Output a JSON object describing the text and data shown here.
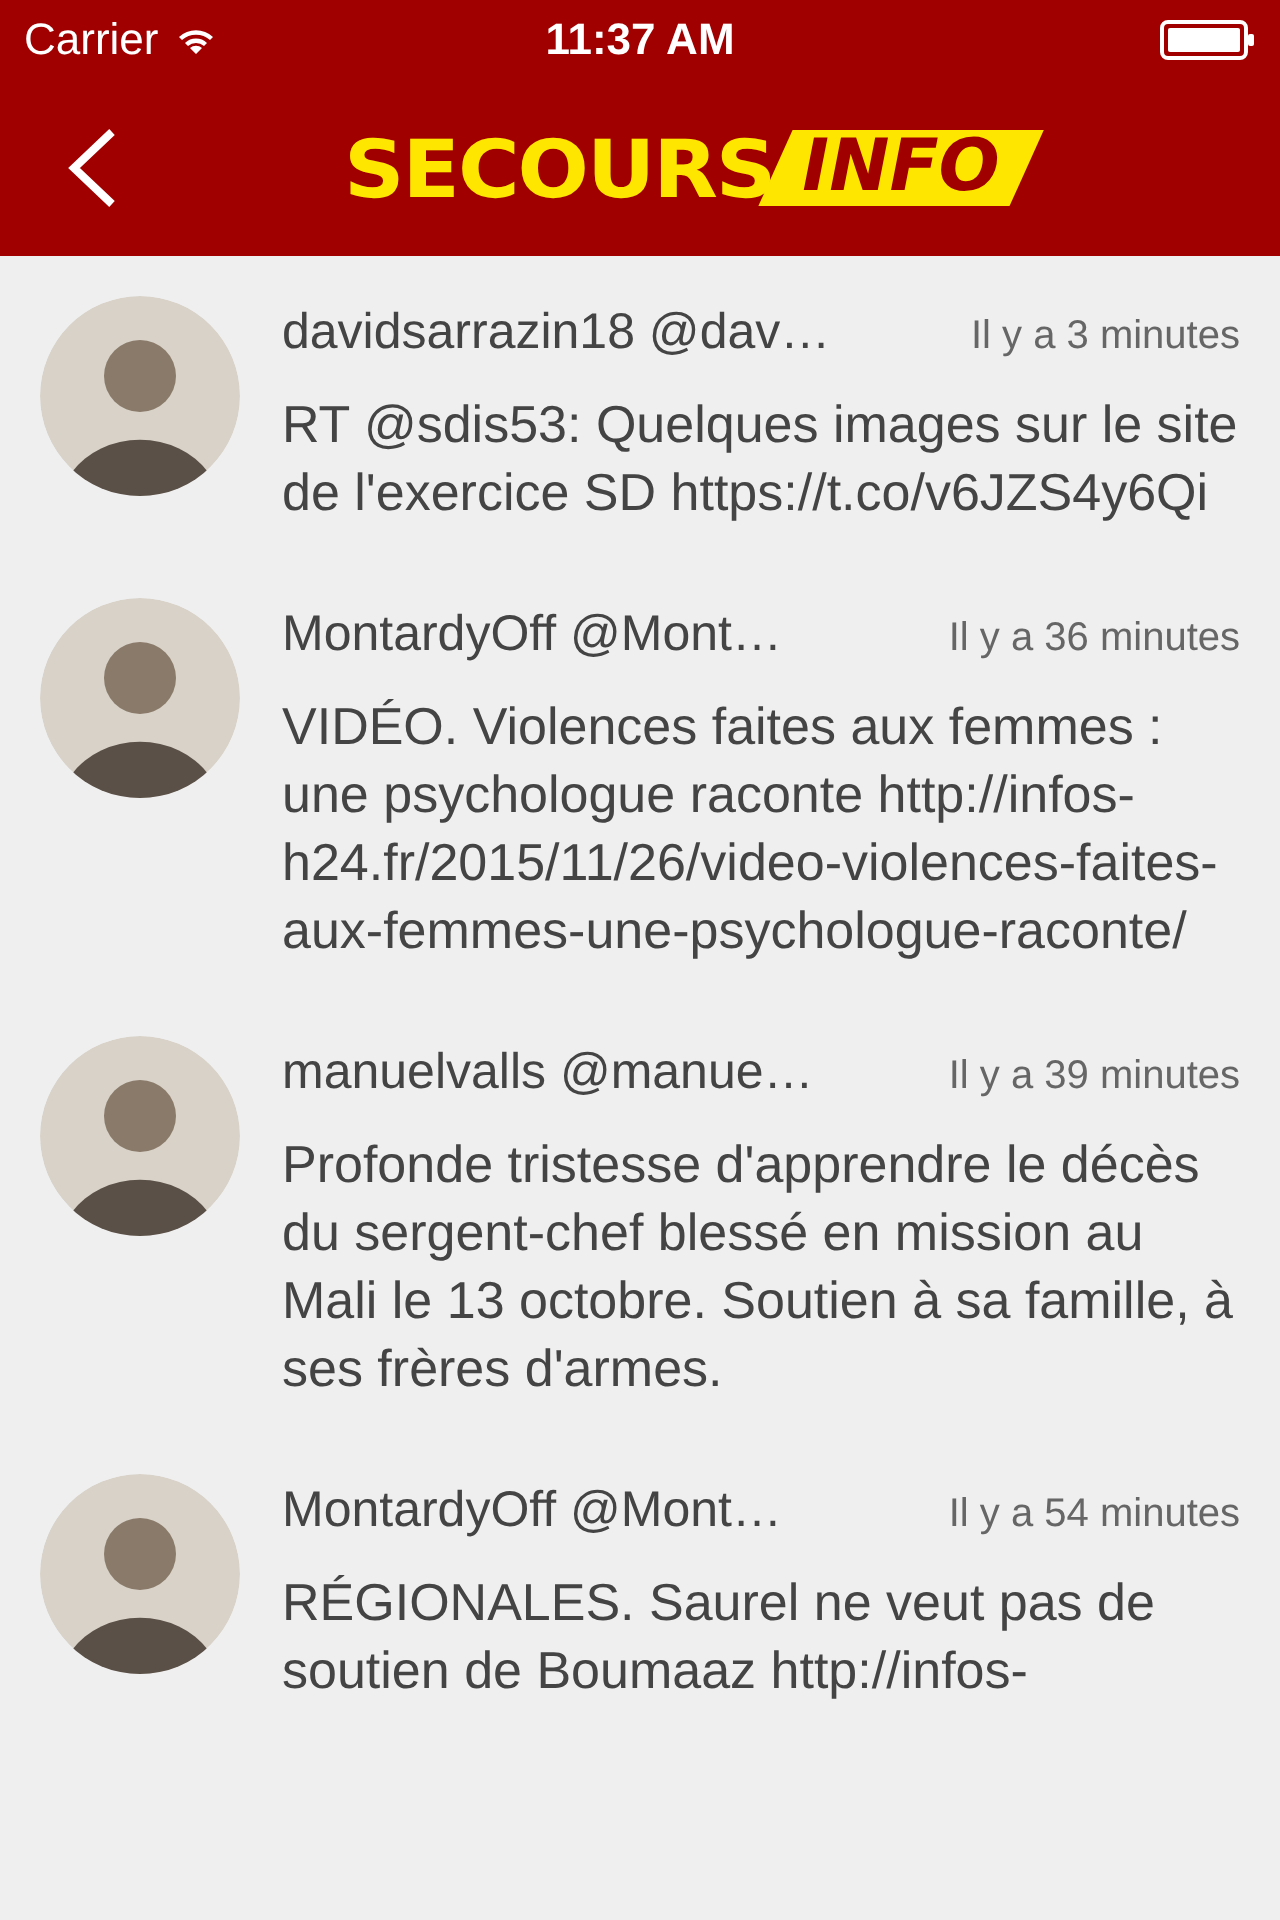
{
  "status_bar": {
    "carrier": "Carrier",
    "time": "11:37 AM"
  },
  "nav_bar": {
    "logo_main": "SECOURS",
    "logo_badge": "INFO"
  },
  "tweets": [
    {
      "author": "davidsarrazin18 @dav…",
      "time": "Il y a 3 minutes",
      "text": "RT @sdis53: Quelques images sur le site de l'exercice SD https://t.co/v6JZS4y6Qi"
    },
    {
      "author": "MontardyOff @Mont…",
      "time": "Il y a 36 minutes",
      "text": "VIDÉO. Violences faites aux femmes : une psychologue raconte http://infos-h24.fr/2015/11/26/video-violences-faites-aux-femmes-une-psychologue-raconte/"
    },
    {
      "author": "manuelvalls @manue…",
      "time": "Il y a 39 minutes",
      "text": "Profonde tristesse d'apprendre le décès du sergent-chef blessé en mission au Mali le 13 octobre. Soutien à sa famille, à ses frères d'armes."
    },
    {
      "author": "MontardyOff @Mont…",
      "time": "Il y a 54 minutes",
      "text": "RÉGIONALES. Saurel ne veut pas de soutien de Boumaaz http://infos-"
    }
  ]
}
